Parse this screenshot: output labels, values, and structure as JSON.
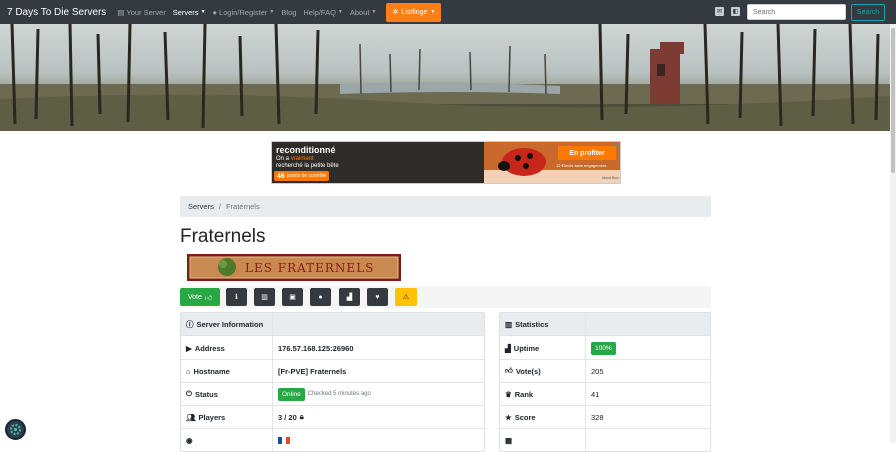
{
  "nav": {
    "brand": "7 Days To Die Servers",
    "items": [
      {
        "label": "Your Server",
        "icon": "server-icon",
        "dropdown": false
      },
      {
        "label": "Servers",
        "icon": "",
        "dropdown": true
      },
      {
        "label": "Login/Register",
        "icon": "user-icon",
        "dropdown": true
      },
      {
        "label": "Blog",
        "icon": "",
        "dropdown": false
      },
      {
        "label": "Help/FAQ",
        "icon": "",
        "dropdown": true
      },
      {
        "label": "About",
        "icon": "",
        "dropdown": true
      }
    ],
    "listing": "Listfinge",
    "search_placeholder": "Search",
    "search_button": "Search"
  },
  "ad": {
    "logo": "reconditionné",
    "line1_a": "On a ",
    "line1_b": "vraiment",
    "line2": "recherché la petite bête",
    "badge_num": "46",
    "badge_text": "points de contrôle",
    "cta": "En profiter",
    "small": "12 €/mois sans engagement",
    "brand": "Ideal·Box"
  },
  "breadcrumb": {
    "link": "Servers",
    "sep": "/",
    "current": "Fraternels"
  },
  "title": "Fraternels",
  "banner_text": "LES FRATERNELS",
  "actions": {
    "vote": "Vote"
  },
  "info": {
    "header": "Server Information",
    "rows": [
      {
        "label": "Address",
        "value": "176.57.168.125:26960"
      },
      {
        "label": "Hostname",
        "value": "[Fr-PVE] Fraternels"
      },
      {
        "label": "Status",
        "value": "Online",
        "note": "Checked 5 minutes ago"
      },
      {
        "label": "Players",
        "value": "3 / 20"
      }
    ]
  },
  "stats": {
    "header": "Statistics",
    "rows": [
      {
        "label": "Uptime",
        "value": "100%"
      },
      {
        "label": "Vote(s)",
        "value": "205"
      },
      {
        "label": "Rank",
        "value": "41"
      },
      {
        "label": "Score",
        "value": "328"
      }
    ]
  },
  "colors": {
    "navbar": "#343a40",
    "success": "#28a745",
    "warning": "#ffc107",
    "listing": "#fd7e14",
    "info": "#17a2b8"
  }
}
